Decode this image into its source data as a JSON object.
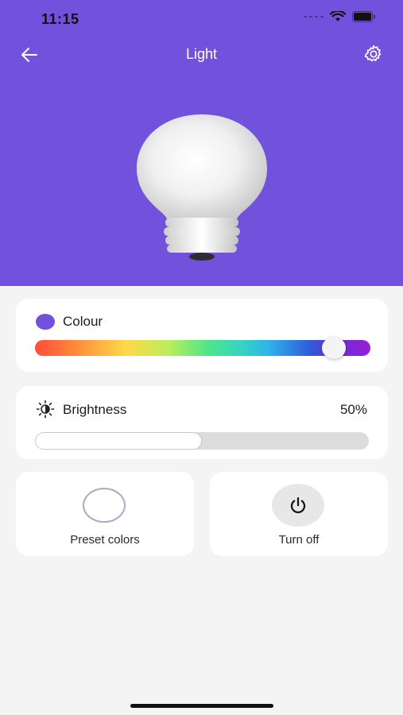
{
  "status_bar": {
    "time": "11:15"
  },
  "nav": {
    "title": "Light"
  },
  "colour": {
    "label": "Colour",
    "selected_color": "#7251dc",
    "slider_position": 0.89
  },
  "brightness": {
    "label": "Brightness",
    "value_text": "50%",
    "level": 0.5
  },
  "actions": {
    "preset_label": "Preset colors",
    "turnoff_label": "Turn off"
  },
  "theme": {
    "accent": "#7251dc",
    "background": "#f4f4f5"
  }
}
